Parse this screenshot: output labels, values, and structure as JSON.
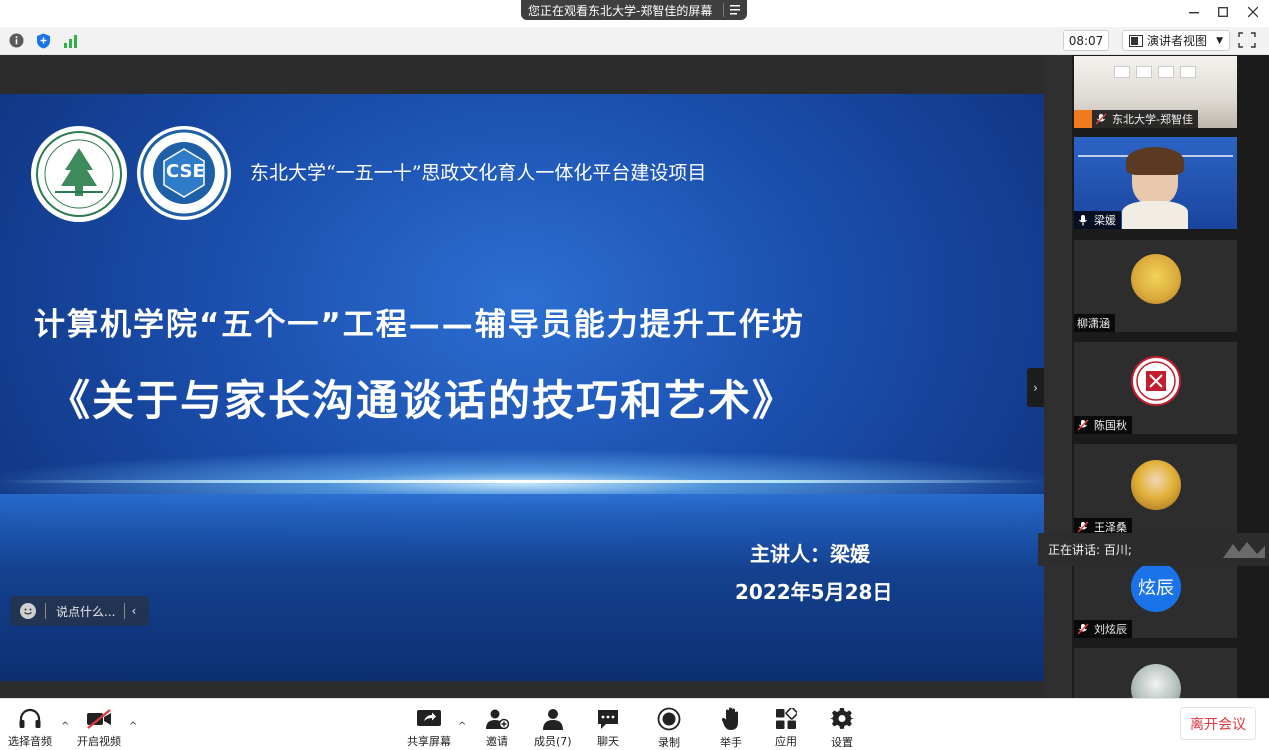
{
  "titlebar": {
    "viewing_banner": "您正在观看东北大学-郑智佳的屏幕"
  },
  "infobar": {
    "time": "08:07",
    "view_mode": "演讲者视图"
  },
  "slide": {
    "header": "东北大学“一五一十”思政文化育人一体化平台建设项目",
    "title_line1": "计算机学院“五个一”工程——辅导员能力提升工作坊",
    "title_line2": "《关于与家长沟通谈话的技巧和艺术》",
    "speaker": "主讲人：梁媛",
    "date": "2022年5月28日",
    "logo2_text": "CSE"
  },
  "chat": {
    "placeholder": "说点什么..."
  },
  "participants": [
    {
      "name": "东北大学-郑智佳"
    },
    {
      "name": "梁媛"
    },
    {
      "name": "柳潇涵"
    },
    {
      "name": "陈国秋"
    },
    {
      "name": "王泽桑"
    },
    {
      "name": "刘炫辰",
      "avatar_text": "炫辰"
    }
  ],
  "speaking": {
    "text": "正在讲话: 百川;"
  },
  "toolbar": {
    "audio": "选择音频",
    "video": "开启视频",
    "share": "共享屏幕",
    "invite": "邀请",
    "members": "成员(7)",
    "chat": "聊天",
    "record": "录制",
    "raise_hand": "举手",
    "apps": "应用",
    "settings": "设置",
    "leave": "离开会议"
  },
  "colors": {
    "accent_blue": "#1a73e8",
    "leave_red": "#e0393e",
    "slide_blue": "#1b4fae"
  }
}
